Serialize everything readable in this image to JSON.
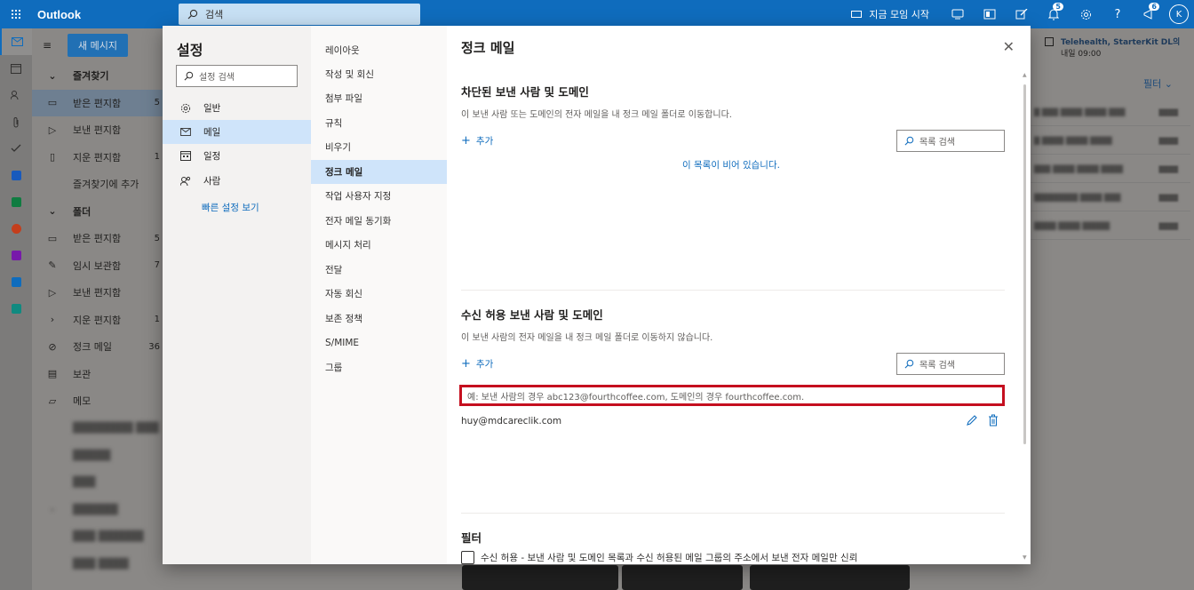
{
  "app": {
    "name": "Outlook",
    "search_placeholder": "검색"
  },
  "topbar": {
    "meet_now": "지금 모임 시작",
    "badge_a": "5",
    "badge_b": "6",
    "avatar_initial": "K"
  },
  "folders": {
    "new_message": "새 메시지",
    "items": [
      {
        "label": "즐겨찾기",
        "count": ""
      },
      {
        "label": "받은 편지함",
        "count": "5"
      },
      {
        "label": "보낸 편지함",
        "count": ""
      },
      {
        "label": "지운 편지함",
        "count": "1"
      },
      {
        "label": "즐겨찾기에 추가",
        "count": ""
      },
      {
        "label": "폴더",
        "count": ""
      },
      {
        "label": "받은 편지함",
        "count": "5"
      },
      {
        "label": "임시 보관함",
        "count": "7"
      },
      {
        "label": "보낸 편지함",
        "count": ""
      },
      {
        "label": "지운 편지함",
        "count": "1"
      },
      {
        "label": "정크 메일",
        "count": "36"
      },
      {
        "label": "보관",
        "count": ""
      },
      {
        "label": "메모",
        "count": ""
      }
    ]
  },
  "calendar_reminder": {
    "title": "Telehealth, StarterKit DL의",
    "time": "내일 09:00"
  },
  "message_list": {
    "filter": "필터"
  },
  "settings": {
    "title": "설정",
    "search_placeholder": "설정 검색",
    "categories": [
      "일반",
      "메일",
      "일정",
      "사람"
    ],
    "quick_settings": "빠른 설정 보기",
    "subcategories": [
      "레이아웃",
      "작성 및 회신",
      "첨부 파일",
      "규칙",
      "비우기",
      "정크 메일",
      "작업 사용자 지정",
      "전자 메일 동기화",
      "메시지 처리",
      "전달",
      "자동 회신",
      "보존 정책",
      "S/MIME",
      "그룹"
    ]
  },
  "junk": {
    "title": "정크 메일",
    "blocked": {
      "title": "차단된 보낸 사람 및 도메인",
      "desc": "이 보낸 사람 또는 도메인의 전자 메일을 내 정크 메일 폴더로 이동합니다.",
      "add": "추가",
      "search": "목록 검색",
      "empty": "이 목록이 비어 있습니다."
    },
    "safe": {
      "title": "수신 허용 보낸 사람 및 도메인",
      "desc": "이 보낸 사람의 전자 메일을 내 정크 메일 폴더로 이동하지 않습니다.",
      "add": "추가",
      "search": "목록 검색",
      "input_placeholder": "예: 보낸 사람의 경우 abc123@fourthcoffee.com, 도메인의 경우 fourthcoffee.com.",
      "entry": "huy@mdcareclik.com"
    },
    "filters": {
      "title": "필터",
      "option": "수신 허용 - 보낸 사람 및 도메인 목록과 수신 허용된 메일 그룹의 주소에서 보낸 전자 메일만 신뢰"
    }
  },
  "colors": {
    "brand": "#0f6cbd",
    "selected": "#cfe4fa",
    "highlight_border": "#c50f1f"
  }
}
